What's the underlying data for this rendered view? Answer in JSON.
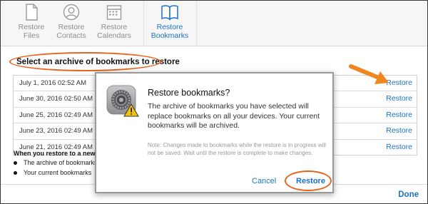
{
  "toolbar": {
    "tabs": [
      {
        "line1": "Restore",
        "line2": "Files",
        "icon": "file-icon"
      },
      {
        "line1": "Restore",
        "line2": "Contacts",
        "icon": "contact-icon"
      },
      {
        "line1": "Restore",
        "line2": "Calendars",
        "icon": "calendar-icon"
      },
      {
        "line1": "Restore",
        "line2": "Bookmarks",
        "icon": "book-icon"
      }
    ],
    "active_tab": "Bookmarks",
    "accent": "#1a73c9"
  },
  "main": {
    "heading": "Select an archive of bookmarks to restore",
    "archives": [
      {
        "date": "July 1, 2016 02:52 AM",
        "action": "Restore"
      },
      {
        "date": "June 30, 2016 02:50 AM",
        "action": "Restore"
      },
      {
        "date": "June 25, 2016 02:49 AM",
        "action": "Restore"
      },
      {
        "date": "June 23, 2016 02:49 AM",
        "action": "Restore"
      },
      {
        "date": "June 21, 2016 02:49 AM",
        "action": "Restore"
      }
    ],
    "info_title": "When you restore to a new",
    "info_bullets": [
      "The archive of bookmarks",
      "Your current bookmarks"
    ],
    "done_label": "Done"
  },
  "dialog": {
    "title": "Restore bookmarks?",
    "body": "The archive of bookmarks you have selected will replace bookmarks on all your devices. Your current bookmarks will be archived.",
    "note": "Note: Changes made to bookmarks while the restore is in progress will not be saved. Wait until the restore is complete to make changes.",
    "cancel_label": "Cancel",
    "confirm_label": "Restore",
    "icon": "settings-warning-icon"
  },
  "annotations": {
    "highlight_color": "#e8641b"
  }
}
